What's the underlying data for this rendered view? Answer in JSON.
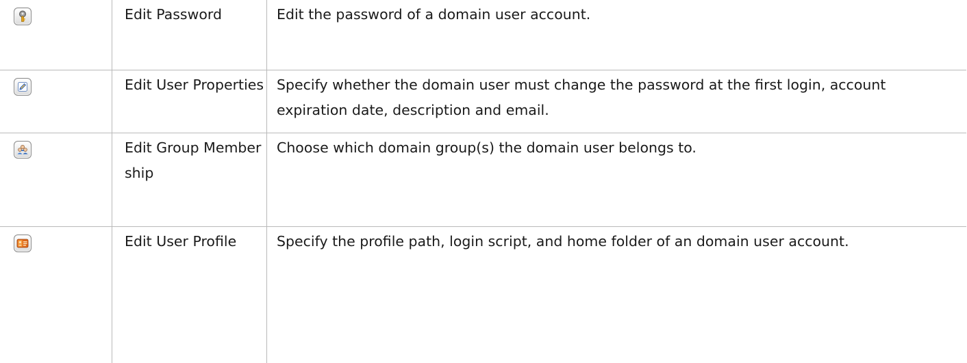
{
  "rows": [
    {
      "icon": "key-icon",
      "name": "Edit Password",
      "description": "Edit the password of a domain user account."
    },
    {
      "icon": "edit-pencil-icon",
      "name": "Edit User Properties",
      "description": "Specify whether the domain user must change the password at the first login, account expiration date, description and email."
    },
    {
      "icon": "group-icon",
      "name": "Edit Group Membership",
      "description": "Choose which domain group(s) the domain user belongs to."
    },
    {
      "icon": "user-profile-icon",
      "name": "Edit User Profile",
      "description": "Specify the profile path, login script, and home folder of an domain user account."
    }
  ],
  "colors": {
    "border": "#b9b9b9",
    "key": "#e0a21c",
    "pencil": "#2b63c6",
    "group": "#3a7bd5",
    "profile": "#e06a1b"
  }
}
